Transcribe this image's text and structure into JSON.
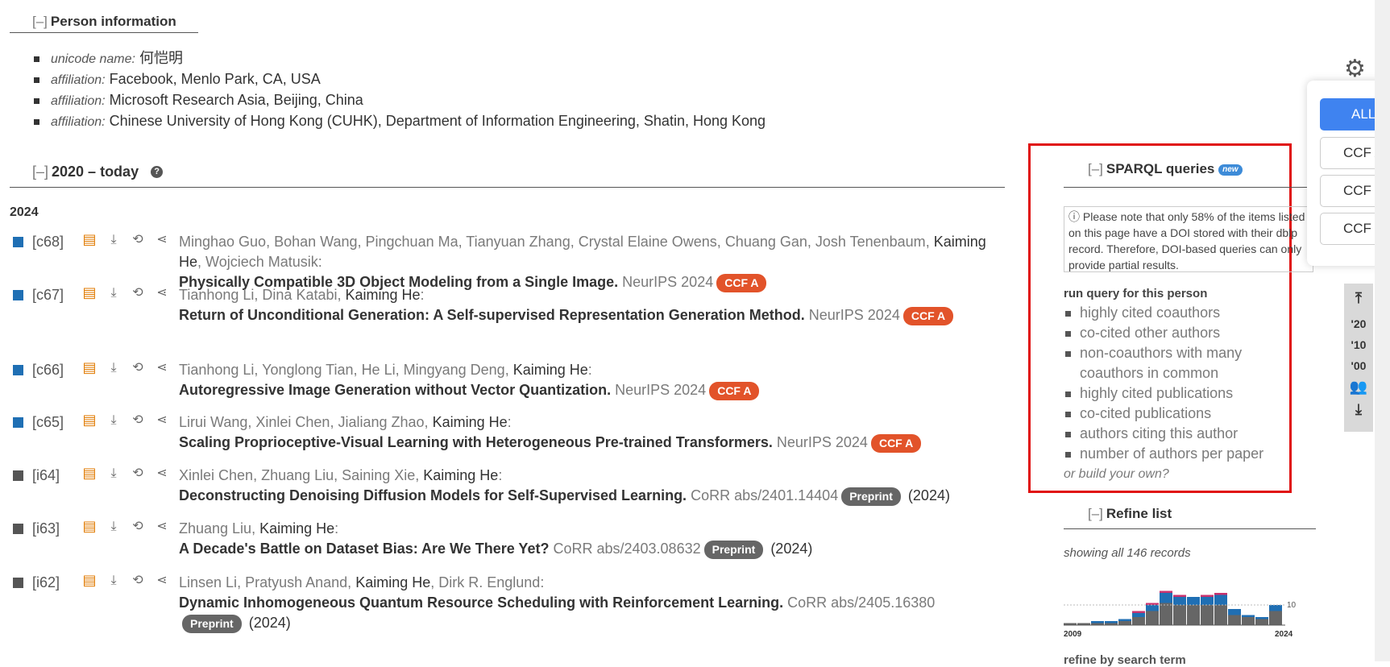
{
  "person_info": {
    "toggle": "[–]",
    "heading": "Person information",
    "items": [
      {
        "label": "unicode name:",
        "value": "何恺明"
      },
      {
        "label": "affiliation:",
        "value": "Facebook, Menlo Park, CA, USA"
      },
      {
        "label": "affiliation:",
        "value": "Microsoft Research Asia, Beijing, China"
      },
      {
        "label": "affiliation:",
        "value": "Chinese University of Hong Kong (CUHK), Department of Information Engineering, Shatin, Hong Kong"
      }
    ]
  },
  "section": {
    "toggle": "[–]",
    "heading": "2020 – today",
    "help_icon": "?"
  },
  "year": "2024",
  "pubs": [
    {
      "key": "[c68]",
      "type": "conf",
      "authors": [
        "Minghao Guo",
        "Bohan Wang",
        "Pingchuan Ma",
        "Tianyuan Zhang",
        "Crystal Elaine Owens",
        "Chuang Gan",
        "Josh Tenenbaum",
        "Kaiming He",
        "Wojciech Matusik"
      ],
      "title": "Physically Compatible 3D Object Modeling from a Single Image.",
      "venue": "NeurIPS 2024",
      "badge": "CCF A",
      "year": ""
    },
    {
      "key": "[c67]",
      "type": "conf",
      "authors": [
        "Tianhong Li",
        "Dina Katabi",
        "Kaiming He"
      ],
      "title": "Return of Unconditional Generation: A Self-supervised Representation Generation Method.",
      "venue": "NeurIPS 2024",
      "badge": "CCF A",
      "year": ""
    },
    {
      "key": "[c66]",
      "type": "conf",
      "authors": [
        "Tianhong Li",
        "Yonglong Tian",
        "He Li",
        "Mingyang Deng",
        "Kaiming He"
      ],
      "title": "Autoregressive Image Generation without Vector Quantization.",
      "venue": "NeurIPS 2024",
      "badge": "CCF A",
      "year": ""
    },
    {
      "key": "[c65]",
      "type": "conf",
      "authors": [
        "Lirui Wang",
        "Xinlei Chen",
        "Jialiang Zhao",
        "Kaiming He"
      ],
      "title": "Scaling Proprioceptive-Visual Learning with Heterogeneous Pre-trained Transformers.",
      "venue": "NeurIPS 2024",
      "badge": "CCF A",
      "year": ""
    },
    {
      "key": "[i64]",
      "type": "inf",
      "authors": [
        "Xinlei Chen",
        "Zhuang Liu",
        "Saining Xie",
        "Kaiming He"
      ],
      "title": "Deconstructing Denoising Diffusion Models for Self-Supervised Learning.",
      "venue": "CoRR abs/2401.14404",
      "badge": "Preprint",
      "year": "(2024)"
    },
    {
      "key": "[i63]",
      "type": "inf",
      "authors": [
        "Zhuang Liu",
        "Kaiming He"
      ],
      "title": "A Decade's Battle on Dataset Bias: Are We There Yet?",
      "venue": "CoRR abs/2403.08632",
      "badge": "Preprint",
      "year": "(2024)"
    },
    {
      "key": "[i62]",
      "type": "inf",
      "authors": [
        "Linsen Li",
        "Pratyush Anand",
        "Kaiming He",
        "Dirk R. Englund"
      ],
      "title": "Dynamic Inhomogeneous Quantum Resource Scheduling with Reinforcement Learning.",
      "venue": "CoRR abs/2405.16380",
      "badge": "Preprint",
      "year": "(2024)"
    }
  ],
  "self_name": "Kaiming He",
  "sparql": {
    "toggle": "[–]",
    "heading": "SPARQL queries",
    "new_badge": "new",
    "note": "ⓘ Please note that only 58% of the items listed on this page have a DOI stored with their dblp record. Therefore, DOI-based queries can only provide partial results.",
    "run_label": "run query for this person",
    "queries": [
      "highly cited coauthors",
      "co-cited other authors",
      "non-coauthors with many coauthors in common",
      "highly cited publications",
      "co-cited publications",
      "authors citing this author",
      "number of authors per paper"
    ],
    "build": "or build your own?"
  },
  "refine": {
    "toggle": "[–]",
    "heading": "Refine list",
    "showing": "showing all 146 records",
    "chart_start": "2009",
    "chart_end": "2024",
    "chart_tick": "10",
    "next_heading": "refine by search term"
  },
  "ccf": {
    "buttons": [
      "ALL",
      "CCF A",
      "CCF B",
      "CCF C"
    ],
    "active": "ALL"
  },
  "sidenav": [
    "'20",
    "'10",
    "'00"
  ],
  "colors": {
    "ccf_a": "#e2532a",
    "preprint": "#666666",
    "conf_square": "#1f6fb4",
    "highlight_box": "#e01010",
    "active_button": "#3f83f0"
  },
  "chart_data": {
    "type": "bar",
    "x": [
      2009,
      2010,
      2011,
      2012,
      2013,
      2014,
      2015,
      2016,
      2017,
      2018,
      2019,
      2020,
      2021,
      2022,
      2023,
      2024
    ],
    "series": [
      {
        "values": [
          1,
          1,
          1,
          1,
          2,
          4,
          7,
          11,
          10,
          10,
          10,
          10,
          5,
          4,
          3,
          7
        ]
      },
      {
        "values": [
          0,
          0,
          1,
          1,
          1,
          2,
          3,
          5,
          4,
          4,
          4,
          5,
          3,
          1,
          1,
          3
        ]
      },
      {
        "values": [
          0,
          0,
          0,
          0,
          0,
          1,
          1,
          1,
          1,
          0,
          1,
          1,
          0,
          0,
          0,
          0
        ]
      }
    ],
    "xlabel": "",
    "ylabel": ""
  }
}
